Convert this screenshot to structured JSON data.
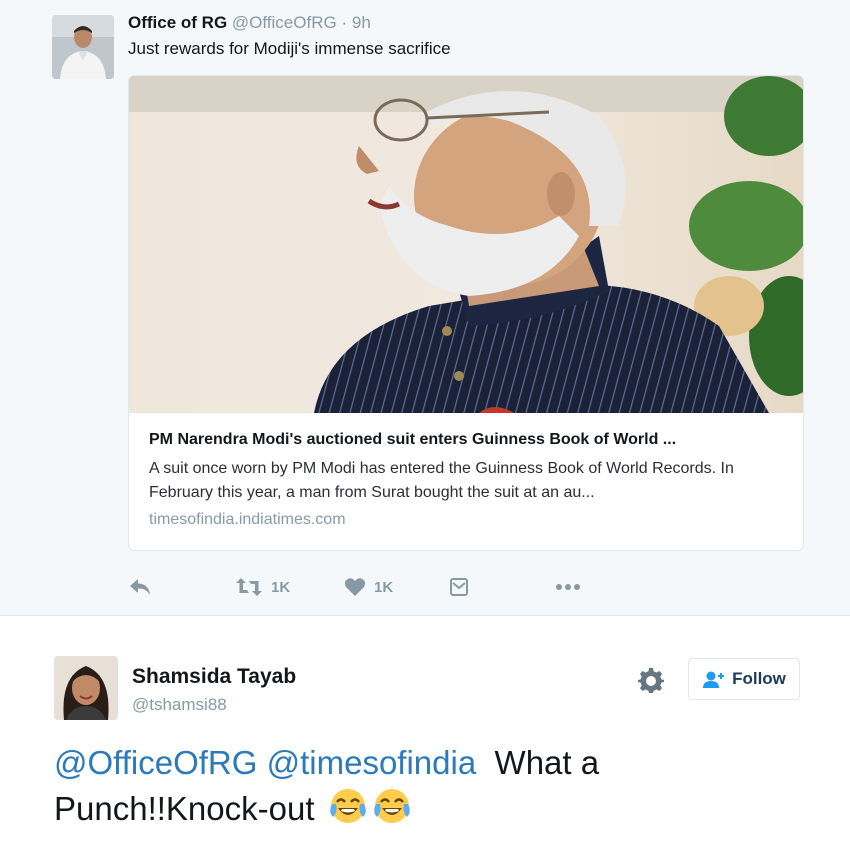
{
  "quoted_tweet": {
    "author_name": "Office of RG",
    "author_handle": "@OfficeOfRG",
    "separator": "·",
    "time": "9h",
    "text": "Just rewards for Modiji's immense sacrifice",
    "card": {
      "title": "PM Narendra Modi's auctioned suit enters Guinness Book of World ...",
      "description": "A suit once worn by PM Modi has entered the Guinness Book of World Records. In February this year, a man from Surat bought the suit at an au...",
      "domain": "timesofindia.indiatimes.com"
    },
    "actions": {
      "reply_icon": "reply-icon",
      "retweet_icon": "retweet-icon",
      "retweet_count": "1K",
      "like_icon": "heart-icon",
      "like_count": "1K",
      "dm_icon": "direct-message-icon",
      "more_icon": "more-dots-icon"
    }
  },
  "reply_tweet": {
    "author_name": "Shamsida Tayab",
    "author_handle": "@tshamsi88",
    "follow_label": "Follow",
    "mentions": [
      "@OfficeOfRG",
      "@timesofindia"
    ],
    "text_part1": "What a",
    "text_part2": "Punch!!Knock-out",
    "emoji": "face-with-tears-of-joy"
  },
  "colors": {
    "link": "#2b7bb9",
    "muted": "#8899a6",
    "background_quoted": "#f5f8fa"
  }
}
